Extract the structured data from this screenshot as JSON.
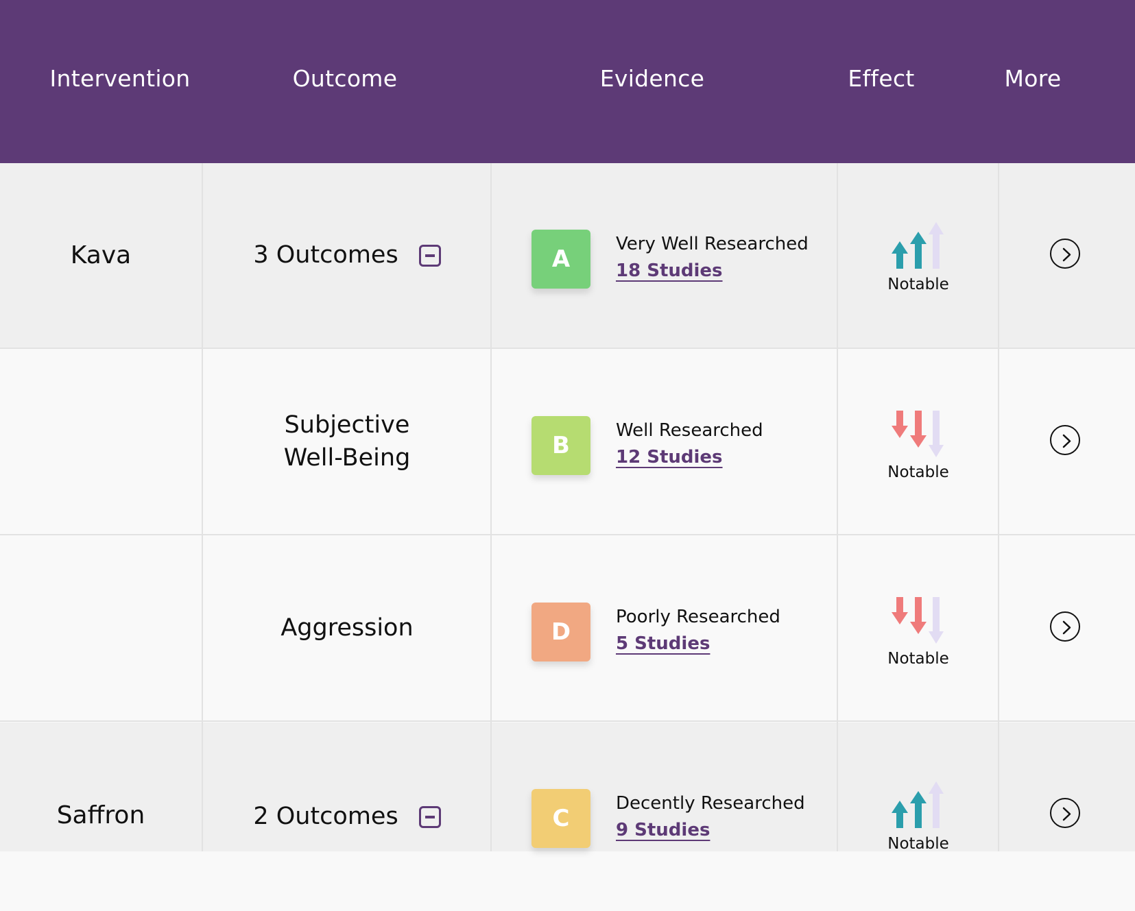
{
  "columns": {
    "intervention": "Intervention",
    "outcome": "Outcome",
    "evidence": "Evidence",
    "effect": "Effect",
    "more": "More"
  },
  "colors": {
    "header_bg": "#5d3a76",
    "grade_A": "#77d07a",
    "grade_B": "#b6dc71",
    "grade_C": "#f2cd74",
    "grade_D": "#f1a882",
    "arrow_up": "#2b9eac",
    "arrow_down": "#ef7b7b",
    "arrow_faded": "#e2dcf3",
    "link": "#5d3a76"
  },
  "rows": [
    {
      "intervention": "Kava",
      "outcome": "3 Outcomes",
      "grade": "A",
      "evidence_level": "Very Well Researched",
      "studies": "18 Studies",
      "effect_direction": "up",
      "effect_label": "Notable"
    },
    {
      "intervention": "",
      "outcome_line1": "Subjective",
      "outcome_line2": "Well-Being",
      "grade": "B",
      "evidence_level": "Well Researched",
      "studies": "12 Studies",
      "effect_direction": "down",
      "effect_label": "Notable"
    },
    {
      "intervention": "",
      "outcome": "Aggression",
      "grade": "D",
      "evidence_level": "Poorly Researched",
      "studies": "5 Studies",
      "effect_direction": "down",
      "effect_label": "Notable"
    },
    {
      "intervention": "Saffron",
      "outcome": "2 Outcomes",
      "grade": "C",
      "evidence_level": "Decently Researched",
      "studies": "9 Studies",
      "effect_direction": "up",
      "effect_label": "Notable"
    }
  ]
}
